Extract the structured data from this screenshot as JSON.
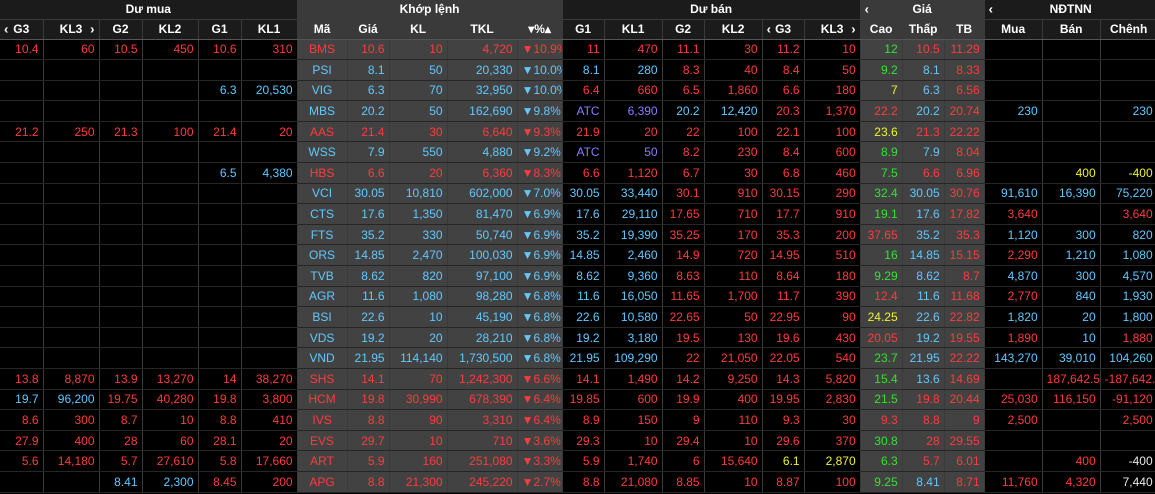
{
  "groups": {
    "du_mua": "Dư mua",
    "khop_lenh": "Khớp lệnh",
    "du_ban": "Dư bán",
    "gia": "Giá",
    "ndtnn": "NĐTNN"
  },
  "columns": {
    "g3": "G3",
    "kl3": "KL3",
    "g2": "G2",
    "kl2": "KL2",
    "g1": "G1",
    "kl1": "KL1",
    "ma": "Mã",
    "gia": "Giá",
    "kl": "KL",
    "tkl": "TKL",
    "pct": "%",
    "s_g1": "G1",
    "s_kl1": "KL1",
    "s_g2": "G2",
    "s_kl2": "KL2",
    "s_g3": "G3",
    "s_kl3": "KL3",
    "cao": "Cao",
    "thap": "Thấp",
    "tb": "TB",
    "mua": "Mua",
    "ban": "Bán",
    "chenh": "Chênh"
  },
  "icons": {
    "prev": "chevron-left-icon",
    "next": "chevron-right-icon",
    "sort": "sort-triangles-icon",
    "down": "down-triangle-icon"
  },
  "colors": {
    "down": "#ff3b3b",
    "up": "#2ee62e",
    "ref": "#f2f22a",
    "floor": "#60c8ff",
    "atc": "#8a7dff"
  },
  "rows": [
    [
      "10.4",
      "60",
      "10.5",
      "450",
      "10.6",
      "310",
      "BMS",
      "10.6",
      "10",
      "4,720",
      "▼10.9%",
      "11",
      "470",
      "11.1",
      "30",
      "11.2",
      "10",
      "12",
      "10.5",
      "11.29",
      "",
      "",
      ""
    ],
    [
      "",
      "",
      "",
      "",
      "",
      "",
      "PSI",
      "8.1",
      "50",
      "20,330",
      "▼10.0%",
      "8.1",
      "280",
      "8.3",
      "40",
      "8.4",
      "50",
      "9.2",
      "8.1",
      "8.33",
      "",
      "",
      ""
    ],
    [
      "",
      "",
      "",
      "",
      "6.3",
      "20,530",
      "VIG",
      "6.3",
      "70",
      "32,950",
      "▼10.0%",
      "6.4",
      "660",
      "6.5",
      "1,860",
      "6.6",
      "180",
      "7",
      "6.3",
      "6.56",
      "",
      "",
      ""
    ],
    [
      "",
      "",
      "",
      "",
      "",
      "",
      "MBS",
      "20.2",
      "50",
      "162,690",
      "▼9.8%",
      "ATC",
      "6,390",
      "20.2",
      "12,420",
      "20.3",
      "1,370",
      "22.2",
      "20.2",
      "20.74",
      "230",
      "",
      "230"
    ],
    [
      "21.2",
      "250",
      "21.3",
      "100",
      "21.4",
      "20",
      "AAS",
      "21.4",
      "30",
      "6,640",
      "▼9.3%",
      "21.9",
      "20",
      "22",
      "100",
      "22.1",
      "100",
      "23.6",
      "21.3",
      "22.22",
      "",
      "",
      ""
    ],
    [
      "",
      "",
      "",
      "",
      "",
      "",
      "WSS",
      "7.9",
      "550",
      "4,880",
      "▼9.2%",
      "ATC",
      "50",
      "8.2",
      "230",
      "8.4",
      "600",
      "8.9",
      "7.9",
      "8.04",
      "",
      "",
      ""
    ],
    [
      "",
      "",
      "",
      "",
      "6.5",
      "4,380",
      "HBS",
      "6.6",
      "20",
      "6,360",
      "▼8.3%",
      "6.6",
      "1,120",
      "6.7",
      "30",
      "6.8",
      "460",
      "7.5",
      "6.6",
      "6.96",
      "",
      "400",
      "-400"
    ],
    [
      "",
      "",
      "",
      "",
      "",
      "",
      "VCI",
      "30.05",
      "10,810",
      "602,000",
      "▼7.0%",
      "30.05",
      "33,440",
      "30.1",
      "910",
      "30.15",
      "290",
      "32.4",
      "30.05",
      "30.76",
      "91,610",
      "16,390",
      "75,220"
    ],
    [
      "",
      "",
      "",
      "",
      "",
      "",
      "CTS",
      "17.6",
      "1,350",
      "81,470",
      "▼6.9%",
      "17.6",
      "29,110",
      "17.65",
      "710",
      "17.7",
      "910",
      "19.1",
      "17.6",
      "17.82",
      "3,640",
      "",
      "3,640"
    ],
    [
      "",
      "",
      "",
      "",
      "",
      "",
      "FTS",
      "35.2",
      "330",
      "50,740",
      "▼6.9%",
      "35.2",
      "19,390",
      "35.25",
      "170",
      "35.3",
      "200",
      "37.65",
      "35.2",
      "35.3",
      "1,120",
      "300",
      "820"
    ],
    [
      "",
      "",
      "",
      "",
      "",
      "",
      "ORS",
      "14.85",
      "2,470",
      "100,030",
      "▼6.9%",
      "14.85",
      "2,460",
      "14.9",
      "720",
      "14.95",
      "510",
      "16",
      "14.85",
      "15.15",
      "2,290",
      "1,210",
      "1,080"
    ],
    [
      "",
      "",
      "",
      "",
      "",
      "",
      "TVB",
      "8.62",
      "820",
      "97,100",
      "▼6.9%",
      "8.62",
      "9,360",
      "8.63",
      "110",
      "8.64",
      "180",
      "9.29",
      "8.62",
      "8.7",
      "4,870",
      "300",
      "4,570"
    ],
    [
      "",
      "",
      "",
      "",
      "",
      "",
      "AGR",
      "11.6",
      "1,080",
      "98,280",
      "▼6.8%",
      "11.6",
      "16,050",
      "11.65",
      "1,700",
      "11.7",
      "390",
      "12.4",
      "11.6",
      "11.68",
      "2,770",
      "840",
      "1,930"
    ],
    [
      "",
      "",
      "",
      "",
      "",
      "",
      "BSI",
      "22.6",
      "10",
      "45,190",
      "▼6.8%",
      "22.6",
      "10,580",
      "22.65",
      "50",
      "22.95",
      "90",
      "24.25",
      "22.6",
      "22.82",
      "1,820",
      "20",
      "1,800"
    ],
    [
      "",
      "",
      "",
      "",
      "",
      "",
      "VDS",
      "19.2",
      "20",
      "28,210",
      "▼6.8%",
      "19.2",
      "3,180",
      "19.5",
      "130",
      "19.6",
      "430",
      "20.05",
      "19.2",
      "19.55",
      "1,890",
      "10",
      "1,880"
    ],
    [
      "",
      "",
      "",
      "",
      "",
      "",
      "VND",
      "21.95",
      "114,140",
      "1,730,500",
      "▼6.8%",
      "21.95",
      "109,290",
      "22",
      "21,050",
      "22.05",
      "540",
      "23.7",
      "21.95",
      "22.22",
      "143,270",
      "39,010",
      "104,260"
    ],
    [
      "13.8",
      "8,870",
      "13.9",
      "13,270",
      "14",
      "38,270",
      "SHS",
      "14.1",
      "70",
      "1,242,300",
      "▼6.6%",
      "14.1",
      "1,490",
      "14.2",
      "9,250",
      "14.3",
      "5,820",
      "15.4",
      "13.6",
      "14.69",
      "",
      "187,642.5",
      "-187,642.5"
    ],
    [
      "19.7",
      "96,200",
      "19.75",
      "40,280",
      "19.8",
      "3,800",
      "HCM",
      "19.8",
      "30,990",
      "678,390",
      "▼6.4%",
      "19.85",
      "600",
      "19.9",
      "400",
      "19.95",
      "2,830",
      "21.5",
      "19.8",
      "20.44",
      "25,030",
      "116,150",
      "-91,120"
    ],
    [
      "8.6",
      "300",
      "8.7",
      "10",
      "8.8",
      "410",
      "IVS",
      "8.8",
      "90",
      "3,310",
      "▼6.4%",
      "8.9",
      "150",
      "9",
      "110",
      "9.3",
      "30",
      "9.3",
      "8.8",
      "9",
      "2,500",
      "",
      "2,500"
    ],
    [
      "27.9",
      "400",
      "28",
      "60",
      "28.1",
      "20",
      "EVS",
      "29.7",
      "10",
      "710",
      "▼3.6%",
      "29.3",
      "10",
      "29.4",
      "10",
      "29.6",
      "370",
      "30.8",
      "28",
      "29.55",
      "",
      "",
      ""
    ],
    [
      "5.6",
      "14,180",
      "5.7",
      "27,610",
      "5.8",
      "17,660",
      "ART",
      "5.9",
      "160",
      "251,080",
      "▼3.3%",
      "5.9",
      "1,740",
      "6",
      "15,640",
      "6.1",
      "2,870",
      "6.3",
      "5.7",
      "6.01",
      "",
      "400",
      "-400"
    ],
    [
      "",
      "",
      "8.41",
      "2,300",
      "8.45",
      "200",
      "APG",
      "8.8",
      "21,300",
      "245,220",
      "▼2.7%",
      "8.8",
      "21,080",
      "8.85",
      "10",
      "8.87",
      "100",
      "9.25",
      "8.41",
      "8.71",
      "11,760",
      "4,320",
      "7,440"
    ]
  ],
  "row_colors": [
    [
      "red",
      "red",
      "red",
      "red",
      "red",
      "red",
      "red",
      "red",
      "red",
      "red",
      "red",
      "red",
      "red",
      "red",
      "red",
      "red",
      "red",
      "grn",
      "red",
      "red",
      "wht",
      "wht",
      "wht"
    ],
    [
      "",
      "",
      "",
      "",
      "",
      "",
      "cyn",
      "cyn",
      "cyn",
      "cyn",
      "cyn",
      "cyn",
      "cyn",
      "red",
      "red",
      "red",
      "red",
      "grn",
      "cyn",
      "red",
      "",
      "",
      ""
    ],
    [
      "",
      "",
      "",
      "",
      "cyn",
      "cyn",
      "cyn",
      "cyn",
      "cyn",
      "cyn",
      "cyn",
      "red",
      "red",
      "red",
      "red",
      "red",
      "red",
      "ylw",
      "cyn",
      "red",
      "",
      "",
      ""
    ],
    [
      "",
      "",
      "",
      "",
      "",
      "",
      "cyn",
      "cyn",
      "cyn",
      "cyn",
      "cyn",
      "pur",
      "pur",
      "cyn",
      "cyn",
      "red",
      "red",
      "red",
      "cyn",
      "red",
      "cyn",
      "",
      "cyn"
    ],
    [
      "red",
      "red",
      "red",
      "red",
      "red",
      "red",
      "red",
      "red",
      "red",
      "red",
      "red",
      "red",
      "red",
      "red",
      "red",
      "red",
      "red",
      "ylw",
      "red",
      "red",
      "",
      "",
      ""
    ],
    [
      "",
      "",
      "",
      "",
      "",
      "",
      "cyn",
      "cyn",
      "cyn",
      "cyn",
      "cyn",
      "pur",
      "pur",
      "red",
      "red",
      "red",
      "red",
      "grn",
      "cyn",
      "red",
      "",
      "",
      ""
    ],
    [
      "",
      "",
      "",
      "",
      "cyn",
      "cyn",
      "red",
      "red",
      "red",
      "red",
      "red",
      "red",
      "red",
      "red",
      "red",
      "red",
      "red",
      "grn",
      "red",
      "red",
      "",
      "ylw",
      "ylw"
    ],
    [
      "",
      "",
      "",
      "",
      "",
      "",
      "cyn",
      "cyn",
      "cyn",
      "cyn",
      "cyn",
      "cyn",
      "cyn",
      "red",
      "red",
      "red",
      "red",
      "grn",
      "cyn",
      "red",
      "cyn",
      "cyn",
      "cyn"
    ],
    [
      "",
      "",
      "",
      "",
      "",
      "",
      "cyn",
      "cyn",
      "cyn",
      "cyn",
      "cyn",
      "cyn",
      "cyn",
      "red",
      "red",
      "red",
      "red",
      "grn",
      "cyn",
      "red",
      "red",
      "",
      "red"
    ],
    [
      "",
      "",
      "",
      "",
      "",
      "",
      "cyn",
      "cyn",
      "cyn",
      "cyn",
      "cyn",
      "cyn",
      "cyn",
      "red",
      "red",
      "red",
      "red",
      "red",
      "cyn",
      "red",
      "cyn",
      "cyn",
      "cyn"
    ],
    [
      "",
      "",
      "",
      "",
      "",
      "",
      "cyn",
      "cyn",
      "cyn",
      "cyn",
      "cyn",
      "cyn",
      "cyn",
      "red",
      "red",
      "red",
      "red",
      "grn",
      "cyn",
      "red",
      "red",
      "cyn",
      "cyn"
    ],
    [
      "",
      "",
      "",
      "",
      "",
      "",
      "cyn",
      "cyn",
      "cyn",
      "cyn",
      "cyn",
      "cyn",
      "cyn",
      "red",
      "red",
      "red",
      "red",
      "grn",
      "cyn",
      "red",
      "cyn",
      "cyn",
      "cyn"
    ],
    [
      "",
      "",
      "",
      "",
      "",
      "",
      "cyn",
      "cyn",
      "cyn",
      "cyn",
      "cyn",
      "cyn",
      "cyn",
      "red",
      "red",
      "red",
      "red",
      "red",
      "cyn",
      "red",
      "red",
      "cyn",
      "cyn"
    ],
    [
      "",
      "",
      "",
      "",
      "",
      "",
      "cyn",
      "cyn",
      "cyn",
      "cyn",
      "cyn",
      "cyn",
      "cyn",
      "red",
      "red",
      "red",
      "red",
      "ylw",
      "cyn",
      "red",
      "cyn",
      "cyn",
      "cyn"
    ],
    [
      "",
      "",
      "",
      "",
      "",
      "",
      "cyn",
      "cyn",
      "cyn",
      "cyn",
      "cyn",
      "cyn",
      "cyn",
      "red",
      "red",
      "red",
      "red",
      "red",
      "cyn",
      "red",
      "red",
      "cyn",
      "red"
    ],
    [
      "",
      "",
      "",
      "",
      "",
      "",
      "cyn",
      "cyn",
      "cyn",
      "cyn",
      "cyn",
      "cyn",
      "cyn",
      "red",
      "red",
      "red",
      "red",
      "grn",
      "cyn",
      "red",
      "cyn",
      "cyn",
      "cyn"
    ],
    [
      "red",
      "red",
      "red",
      "red",
      "red",
      "red",
      "red",
      "red",
      "red",
      "red",
      "red",
      "red",
      "red",
      "red",
      "red",
      "red",
      "red",
      "grn",
      "cyn",
      "red",
      "",
      "red",
      "red"
    ],
    [
      "cyn",
      "cyn",
      "red",
      "red",
      "red",
      "red",
      "red",
      "red",
      "red",
      "red",
      "red",
      "red",
      "red",
      "red",
      "red",
      "red",
      "red",
      "grn",
      "red",
      "red",
      "red",
      "red",
      "red"
    ],
    [
      "red",
      "red",
      "red",
      "red",
      "red",
      "red",
      "red",
      "red",
      "red",
      "red",
      "red",
      "red",
      "red",
      "red",
      "red",
      "red",
      "red",
      "red",
      "red",
      "red",
      "red",
      "",
      "red"
    ],
    [
      "red",
      "red",
      "red",
      "red",
      "red",
      "red",
      "red",
      "red",
      "red",
      "red",
      "red",
      "red",
      "red",
      "red",
      "red",
      "red",
      "red",
      "grn",
      "red",
      "red",
      "",
      "",
      ""
    ],
    [
      "red",
      "red",
      "red",
      "red",
      "red",
      "red",
      "red",
      "red",
      "red",
      "red",
      "red",
      "red",
      "red",
      "red",
      "red",
      "ylw",
      "ylw",
      "grn",
      "red",
      "red",
      "",
      "red",
      "wht"
    ],
    [
      "",
      "",
      "cyn",
      "cyn",
      "red",
      "red",
      "red",
      "red",
      "red",
      "red",
      "red",
      "red",
      "red",
      "red",
      "red",
      "red",
      "red",
      "grn",
      "cyn",
      "red",
      "red",
      "red",
      "wht"
    ]
  ]
}
